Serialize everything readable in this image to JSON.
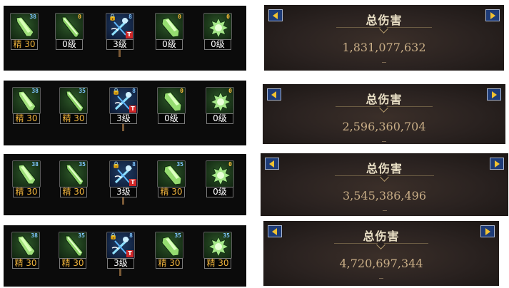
{
  "rows": [
    {
      "skills": [
        {
          "icon": "blade-skill-icon",
          "count": "38",
          "level": "精 30",
          "level_color": "gold",
          "tile": "green",
          "extras": false
        },
        {
          "icon": "sword-skill-icon",
          "count": "0",
          "level": "0级",
          "level_color": "white",
          "tile": "green",
          "extras": false
        },
        {
          "icon": "locked-tech-skill-icon",
          "count": "8",
          "level": "3级",
          "level_color": "white",
          "tile": "blue",
          "extras": true
        },
        {
          "icon": "slash-skill-icon",
          "count": "0",
          "level": "0级",
          "level_color": "white",
          "tile": "green",
          "extras": false
        },
        {
          "icon": "burst-skill-icon",
          "count": "0",
          "level": "0级",
          "level_color": "white",
          "tile": "green",
          "extras": false
        }
      ],
      "panel": {
        "title": "总伤害",
        "damage": "1,831,077,632"
      }
    },
    {
      "skills": [
        {
          "icon": "blade-skill-icon",
          "count": "38",
          "level": "精 30",
          "level_color": "gold",
          "tile": "green",
          "extras": false
        },
        {
          "icon": "sword-skill-icon",
          "count": "35",
          "level": "精 30",
          "level_color": "gold",
          "tile": "green",
          "extras": false
        },
        {
          "icon": "locked-tech-skill-icon",
          "count": "8",
          "level": "3级",
          "level_color": "white",
          "tile": "blue",
          "extras": true
        },
        {
          "icon": "slash-skill-icon",
          "count": "0",
          "level": "0级",
          "level_color": "white",
          "tile": "green",
          "extras": false
        },
        {
          "icon": "burst-skill-icon",
          "count": "0",
          "level": "0级",
          "level_color": "white",
          "tile": "green",
          "extras": false
        }
      ],
      "panel": {
        "title": "总伤害",
        "damage": "2,596,360,704"
      }
    },
    {
      "skills": [
        {
          "icon": "blade-skill-icon",
          "count": "38",
          "level": "精 30",
          "level_color": "gold",
          "tile": "green",
          "extras": false
        },
        {
          "icon": "sword-skill-icon",
          "count": "35",
          "level": "精 30",
          "level_color": "gold",
          "tile": "green",
          "extras": false
        },
        {
          "icon": "locked-tech-skill-icon",
          "count": "8",
          "level": "3级",
          "level_color": "white",
          "tile": "blue",
          "extras": true
        },
        {
          "icon": "slash-skill-icon",
          "count": "35",
          "level": "精 30",
          "level_color": "gold",
          "tile": "green",
          "extras": false
        },
        {
          "icon": "burst-skill-icon",
          "count": "0",
          "level": "0级",
          "level_color": "white",
          "tile": "green",
          "extras": false
        }
      ],
      "panel": {
        "title": "总伤害",
        "damage": "3,545,386,496"
      }
    },
    {
      "skills": [
        {
          "icon": "blade-skill-icon",
          "count": "38",
          "level": "精 30",
          "level_color": "gold",
          "tile": "green",
          "extras": false
        },
        {
          "icon": "sword-skill-icon",
          "count": "35",
          "level": "精 30",
          "level_color": "gold",
          "tile": "green",
          "extras": false
        },
        {
          "icon": "locked-tech-skill-icon",
          "count": "8",
          "level": "3级",
          "level_color": "white",
          "tile": "blue",
          "extras": true
        },
        {
          "icon": "slash-skill-icon",
          "count": "35",
          "level": "精 30",
          "level_color": "gold",
          "tile": "green",
          "extras": false
        },
        {
          "icon": "burst-skill-icon",
          "count": "35",
          "level": "精 30",
          "level_color": "gold",
          "tile": "green",
          "extras": false
        }
      ],
      "panel": {
        "title": "总伤害",
        "damage": "4,720,697,344"
      }
    }
  ],
  "lock_glyph": "🔒",
  "tag_label": "T",
  "colors": {
    "gold": "#f0b43c",
    "count_blue": "#7fc6ff",
    "count_orange": "#ffbf3a",
    "nav_arrow": "#f2c230",
    "damage_text": "#c8ad86"
  }
}
